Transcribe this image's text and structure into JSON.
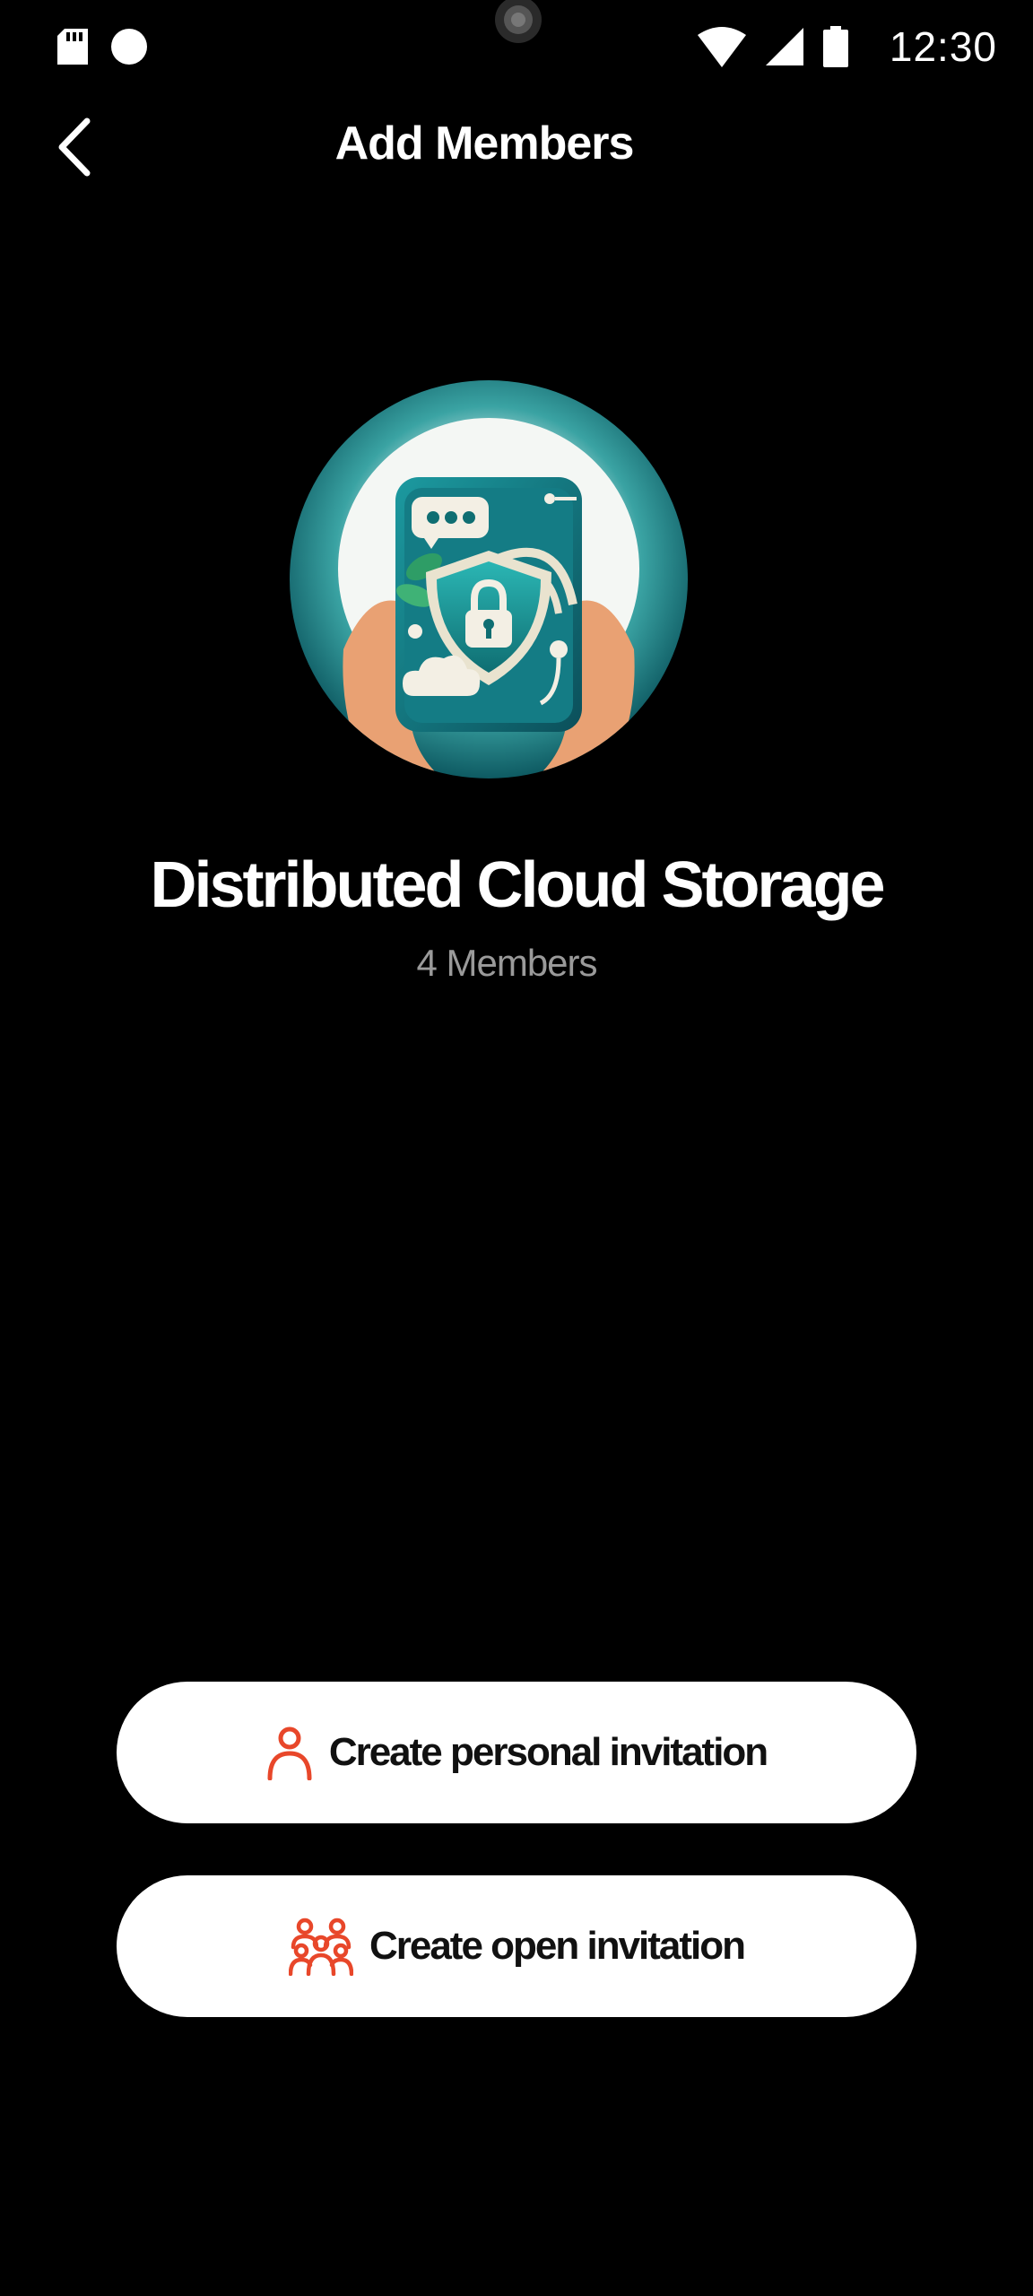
{
  "status_bar": {
    "time": "12:30",
    "icons": [
      "sd-card-icon",
      "notification-dot-icon",
      "wifi-icon",
      "cellular-signal-icon",
      "battery-icon"
    ]
  },
  "header": {
    "back_icon": "chevron-left-icon",
    "title": "Add Members"
  },
  "group": {
    "avatar_icon": "secure-phone-shield-lock-illustration",
    "name": "Distributed Cloud Storage",
    "member_count": "4 Members"
  },
  "actions": {
    "personal_invite": {
      "icon": "person-outline-icon",
      "label": "Create personal invitation"
    },
    "open_invite": {
      "icon": "group-outline-icon",
      "label": "Create open invitation"
    }
  },
  "colors": {
    "background": "#000000",
    "accent": "#e8472a",
    "button_bg": "#ffffff",
    "subtle_text": "#9a9a9a",
    "illustration_teal": "#0f6f76"
  }
}
